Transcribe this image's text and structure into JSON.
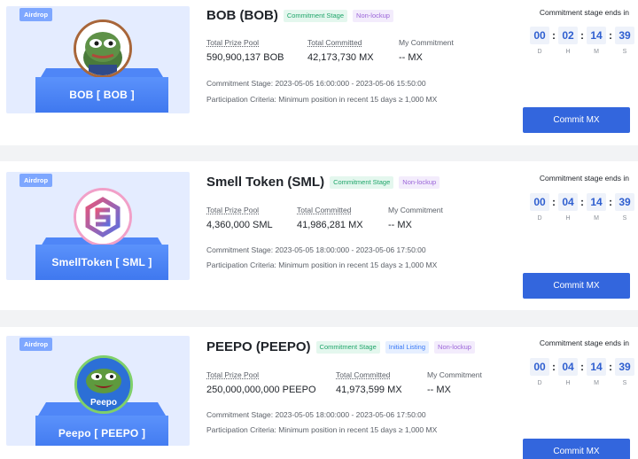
{
  "cards": [
    {
      "airdrop_tag": "Airdrop",
      "token_box_label": "BOB [ BOB ]",
      "title": "BOB (BOB)",
      "tags": [
        "Commitment Stage",
        "Non-lockup"
      ],
      "total_prize_pool_label": "Total Prize Pool",
      "total_prize_pool": "590,900,137 BOB",
      "total_committed_label": "Total Committed",
      "total_committed": "42,173,730 MX",
      "my_commitment_label": "My Commitment",
      "my_commitment": "-- MX",
      "commitment_stage": "Commitment Stage: 2023-05-05 16:00:000 - 2023-05-06 15:50:00",
      "participation_criteria": "Participation Criteria: Minimum position in recent 15 days ≥ 1,000 MX",
      "countdown_label": "Commitment stage ends in",
      "countdown": {
        "d": "00",
        "h": "02",
        "m": "14",
        "s": "39"
      },
      "countdown_units": {
        "d": "D",
        "h": "H",
        "m": "M",
        "s": "S"
      },
      "button_label": "Commit MX"
    },
    {
      "airdrop_tag": "Airdrop",
      "token_box_label": "SmellToken [ SML ]",
      "title": "Smell Token (SML)",
      "tags": [
        "Commitment Stage",
        "Non-lockup"
      ],
      "total_prize_pool_label": "Total Prize Pool",
      "total_prize_pool": "4,360,000 SML",
      "total_committed_label": "Total Committed",
      "total_committed": "41,986,281 MX",
      "my_commitment_label": "My Commitment",
      "my_commitment": "-- MX",
      "commitment_stage": "Commitment Stage: 2023-05-05 18:00:000 - 2023-05-06 17:50:00",
      "participation_criteria": "Participation Criteria: Minimum position in recent 15 days ≥ 1,000 MX",
      "countdown_label": "Commitment stage ends in",
      "countdown": {
        "d": "00",
        "h": "04",
        "m": "14",
        "s": "39"
      },
      "countdown_units": {
        "d": "D",
        "h": "H",
        "m": "M",
        "s": "S"
      },
      "button_label": "Commit MX"
    },
    {
      "airdrop_tag": "Airdrop",
      "token_box_label": "Peepo [ PEEPO ]",
      "coin_text": "Peepo",
      "title": "PEEPO (PEEPO)",
      "tags": [
        "Commitment Stage",
        "Initial Listing",
        "Non-lockup"
      ],
      "total_prize_pool_label": "Total Prize Pool",
      "total_prize_pool": "250,000,000,000 PEEPO",
      "total_committed_label": "Total Committed",
      "total_committed": "41,973,599 MX",
      "my_commitment_label": "My Commitment",
      "my_commitment": "-- MX",
      "commitment_stage": "Commitment Stage: 2023-05-05 18:00:000 - 2023-05-06 17:50:00",
      "participation_criteria": "Participation Criteria: Minimum position in recent 15 days ≥ 1,000 MX",
      "countdown_label": "Commitment stage ends in",
      "countdown": {
        "d": "00",
        "h": "04",
        "m": "14",
        "s": "39"
      },
      "countdown_units": {
        "d": "D",
        "h": "H",
        "m": "M",
        "s": "S"
      },
      "button_label": "Commit MX"
    }
  ],
  "colors": {
    "accent": "#3366dd",
    "banner_bg": "#e4ecff",
    "tag_green": "#1fa56a",
    "tag_purple": "#9a64d8",
    "tag_blue": "#3b7af5"
  }
}
